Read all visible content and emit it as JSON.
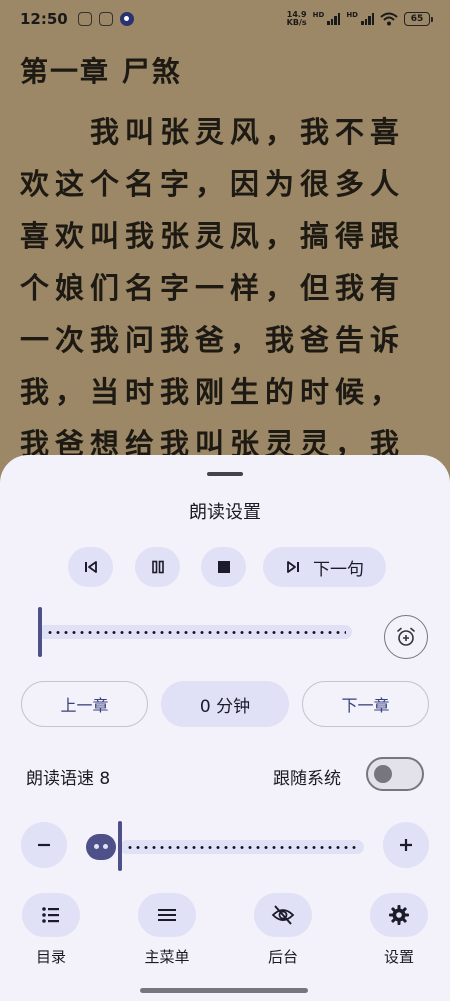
{
  "status_bar": {
    "time": "12:50",
    "net_speed_value": "14.9",
    "net_speed_unit": "KB/s",
    "signal_1_label": "HD",
    "signal_2_label": "HD",
    "battery": "65"
  },
  "reader": {
    "chapter_title": "第一章 尸煞",
    "body_text": "我叫张灵风，我不喜欢这个名字，因为很多人喜欢叫我张灵凤，搞得跟个娘们名字一样，但我有一次我问我爸，我爸告诉我，当时我刚生的时候，我爸想给我叫张灵灵，我"
  },
  "sheet": {
    "title": "朗读设置",
    "next_sentence_label": "下一句",
    "progress_fraction": 0.0,
    "prev_chapter_label": "上一章",
    "timer_label": "0 分钟",
    "next_chapter_label": "下一章",
    "speed_label": "朗读语速 8",
    "follow_system_label": "跟随系统",
    "follow_system_on": false
  },
  "bottom_nav": {
    "items": [
      {
        "label": "目录",
        "icon": "list-icon"
      },
      {
        "label": "主菜单",
        "icon": "menu-icon"
      },
      {
        "label": "后台",
        "icon": "eye-off-icon"
      },
      {
        "label": "设置",
        "icon": "gear-icon"
      }
    ]
  },
  "colors": {
    "page_background": "#9c8766",
    "sheet_background": "#f3f1f9",
    "accent": "#4d5188",
    "button_fill": "#e0e0f6"
  }
}
